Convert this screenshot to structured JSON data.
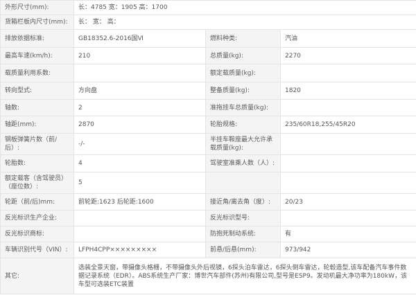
{
  "rows": [
    {
      "type": "wide",
      "label": "外形尺寸(mm):",
      "value": "长：4785 宽：1905 高：1700"
    },
    {
      "type": "wide",
      "label": "货箱栏板内尺寸(mm):",
      "value": "长： 宽： 高："
    },
    {
      "type": "pair",
      "label1": "排放依据标准:",
      "value1": "GB18352.6-2016国Ⅵ",
      "label2": "燃料种类:",
      "value2": "汽油"
    },
    {
      "type": "pair",
      "label1": "最高车速(km/h):",
      "value1": "210",
      "label2": "总质量(kg):",
      "value2": "2270"
    },
    {
      "type": "pair",
      "label1": "载质量利用系数:",
      "value1": "",
      "label2": "额定载质量(kg):",
      "value2": ""
    },
    {
      "type": "pair",
      "label1": "转向型式:",
      "value1": "方向盘",
      "label2": "整备质量(kg):",
      "value2": "1820"
    },
    {
      "type": "pair",
      "label1": "轴数:",
      "value1": "2",
      "label2": "准拖挂车总质量(kg):",
      "value2": ""
    },
    {
      "type": "pair",
      "label1": "轴距(mm):",
      "value1": "2870",
      "label2": "轮胎规格:",
      "value2": "235/60R18,255/45R20"
    },
    {
      "type": "pair",
      "label1": "钢板弹簧片数（前/后）:",
      "value1": "-/-",
      "label2": "半挂车鞍座最大允许承载质量(kg):",
      "value2": ""
    },
    {
      "type": "pair",
      "label1": "轮胎数:",
      "value1": "4",
      "label2": "驾驶室准乘人数（人）:",
      "value2": ""
    },
    {
      "type": "pair",
      "label1": "额定载客（含驾驶员）（座位数）:",
      "value1": "5",
      "label2": "",
      "value2": ""
    },
    {
      "type": "pair",
      "label1": "轮距（前/后)mm:",
      "value1": "前轮距:1623 后轮距:1600",
      "label2": "接近角/离去角（度）:",
      "value2": "20/23"
    },
    {
      "type": "pair",
      "label1": "反光标识生产企业:",
      "value1": "",
      "label2": "反光标识型号:",
      "value2": ""
    },
    {
      "type": "pair",
      "label1": "反光标识商标:",
      "value1": "",
      "label2": "防抱死制动系统:",
      "value2": "有"
    },
    {
      "type": "pair",
      "label1": "车辆识别代号（VIN）:",
      "value1": "LFPH4CPP×××××××××",
      "label2": "前悬/后悬(mm):",
      "value2": "973/942"
    },
    {
      "type": "wide",
      "label": "其它:",
      "value": "选装全景天窗，带摄像头格栅，不带摄像头外后视镜，6探头泊车雷达，6探头倒车雷达，轮毂造型,该车配备汽车事件数据记录系统（EDR）。ABS系统生产厂家：博世汽车部件(苏州)有限公司,型号是ESP9。发动机最大净功率为180kW，该车型可选装ETC装置"
    }
  ]
}
